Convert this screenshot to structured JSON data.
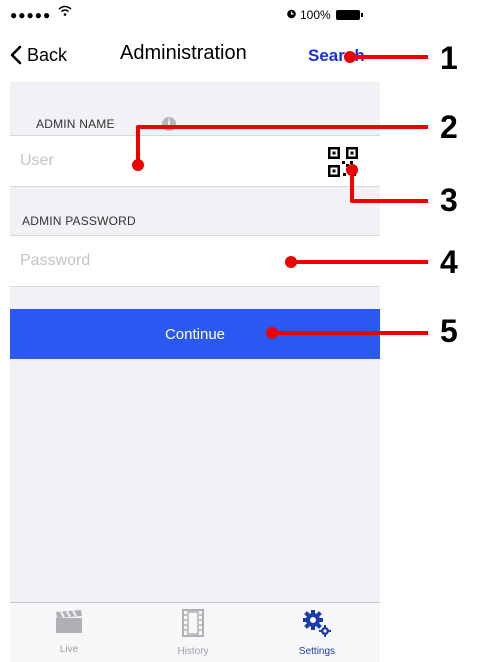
{
  "status": {
    "signal": "●●●●●",
    "battery_pct": "100%"
  },
  "nav": {
    "back_label": "Back",
    "title": "Administration",
    "search_label": "Search"
  },
  "admin_name": {
    "section_label": "ADMIN NAME",
    "info_glyph": "i",
    "placeholder": "User"
  },
  "admin_password": {
    "section_label": "ADMIN PASSWORD",
    "placeholder": "Password"
  },
  "continue_label": "Continue",
  "tabs": [
    {
      "label": "Live",
      "icon": "clapperboard-icon"
    },
    {
      "label": "History",
      "icon": "film-icon"
    },
    {
      "label": "Settings",
      "icon": "gears-icon"
    }
  ],
  "annotations": [
    "1",
    "2",
    "3",
    "4",
    "5"
  ],
  "colors": {
    "accent": "#2b58f0",
    "search": "#1a2fe0",
    "annotation": "#ee0000"
  }
}
